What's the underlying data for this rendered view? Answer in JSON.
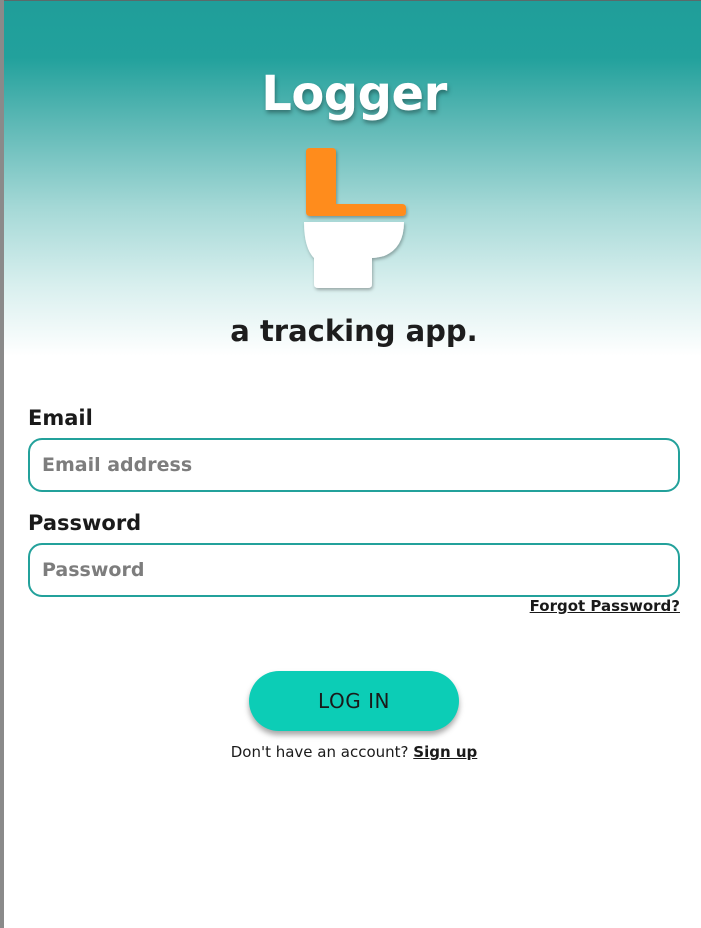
{
  "header": {
    "app_name": "Logger",
    "tagline": "a tracking app."
  },
  "logo": {
    "icon": "toilet-icon",
    "seat_color": "#ff8c1a",
    "bowl_color": "#ffffff"
  },
  "form": {
    "email_label": "Email",
    "email_placeholder": "Email address",
    "email_value": "",
    "password_label": "Password",
    "password_placeholder": "Password",
    "password_value": "",
    "forgot_password": "Forgot Password?"
  },
  "actions": {
    "login_label": "LOG IN",
    "signup_prompt": "Don't have an account?",
    "signup_link": "Sign up"
  },
  "colors": {
    "header_gradient_top": "#1f9e9a",
    "input_border": "#23a19b",
    "button_bg": "#0ccdb6"
  }
}
